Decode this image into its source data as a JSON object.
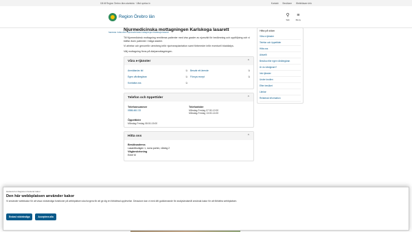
{
  "topbar": {
    "left": "Gå till Region Örebro läns startsida",
    "left2": "Vård spelas in",
    "links": [
      "Kontakt",
      "Besökare",
      "Webbläsare info"
    ]
  },
  "header": {
    "logo_text": "Region Örebro län",
    "search_label": "Sök",
    "menu_label": "Meny"
  },
  "breadcrumb": "Startsida / Hitta vård / Njurmedicinska mottagningen Karlskoga lasarett",
  "page": {
    "title": "Njurmedicinska mottagningen Karlskoga lasarett",
    "paragraphs": [
      "Till Njurmedicinsk mottagning remitteras patienter med viss grader av njursvikt för bedömning och uppföljning och vi träffar även patienter i tidiga stadier.",
      "Vi arbetar och genomför utredning inför njurtransplantation samt förbereder inför eventuell bloddialys.",
      "Välj mottagning finns på dialysmottagningen."
    ]
  },
  "services": {
    "title": "Våra e-tjänster",
    "items": [
      "Anmälan/av tid",
      "Besvär ett ärende",
      "Egen vårdbegäran",
      "Förnya recept",
      "Kontakta oss"
    ]
  },
  "phone": {
    "title": "Telefon och öppettider",
    "number_label": "Telefonnummer",
    "number": "0586-661 33",
    "hours_label": "Telefontider",
    "hours": [
      "Måndag-Fredag 07:30-12:00",
      "Måndag-Fredag 13:00-14:00"
    ],
    "open_label": "Öppettider",
    "open": "Måndag-Fredag 08:00-15:00"
  },
  "find": {
    "title": "Hitta oss",
    "visit_label": "Besöksadress",
    "visit": "Lasarettsvägen 1, norra porten, våning 2",
    "way_label": "Vägbeskrivning",
    "way": "Entré M"
  },
  "sidebar": {
    "title": "Hitta på sidan",
    "items": [
      "Våra e-tjänster",
      "Telefon och öppettider",
      "Hitta oss",
      "Aktuellt",
      "Besöka eller egen vårdbegäran",
      "Är du vårdgivare?",
      "Info tjänster",
      "Under knollen",
      "Efter besöket",
      "Länkar",
      "Relaterad information"
    ]
  },
  "cookie": {
    "small": "Hantera hur Regionen hanterar kakor",
    "title": "Den här webbplatsen använder kakor",
    "text": "Vi använder webbkakor för att vissa nödvändiga funktioner på webbplatsen ska fungera för att ge dig en förbättrad upplevelse. Dessutom kan vi med ditt godkännande för analysändamål använda kakor för att förbättra webbplatsen.",
    "btn_necessary": "Endast nödvändiga",
    "btn_accept": "Acceptera alla"
  }
}
